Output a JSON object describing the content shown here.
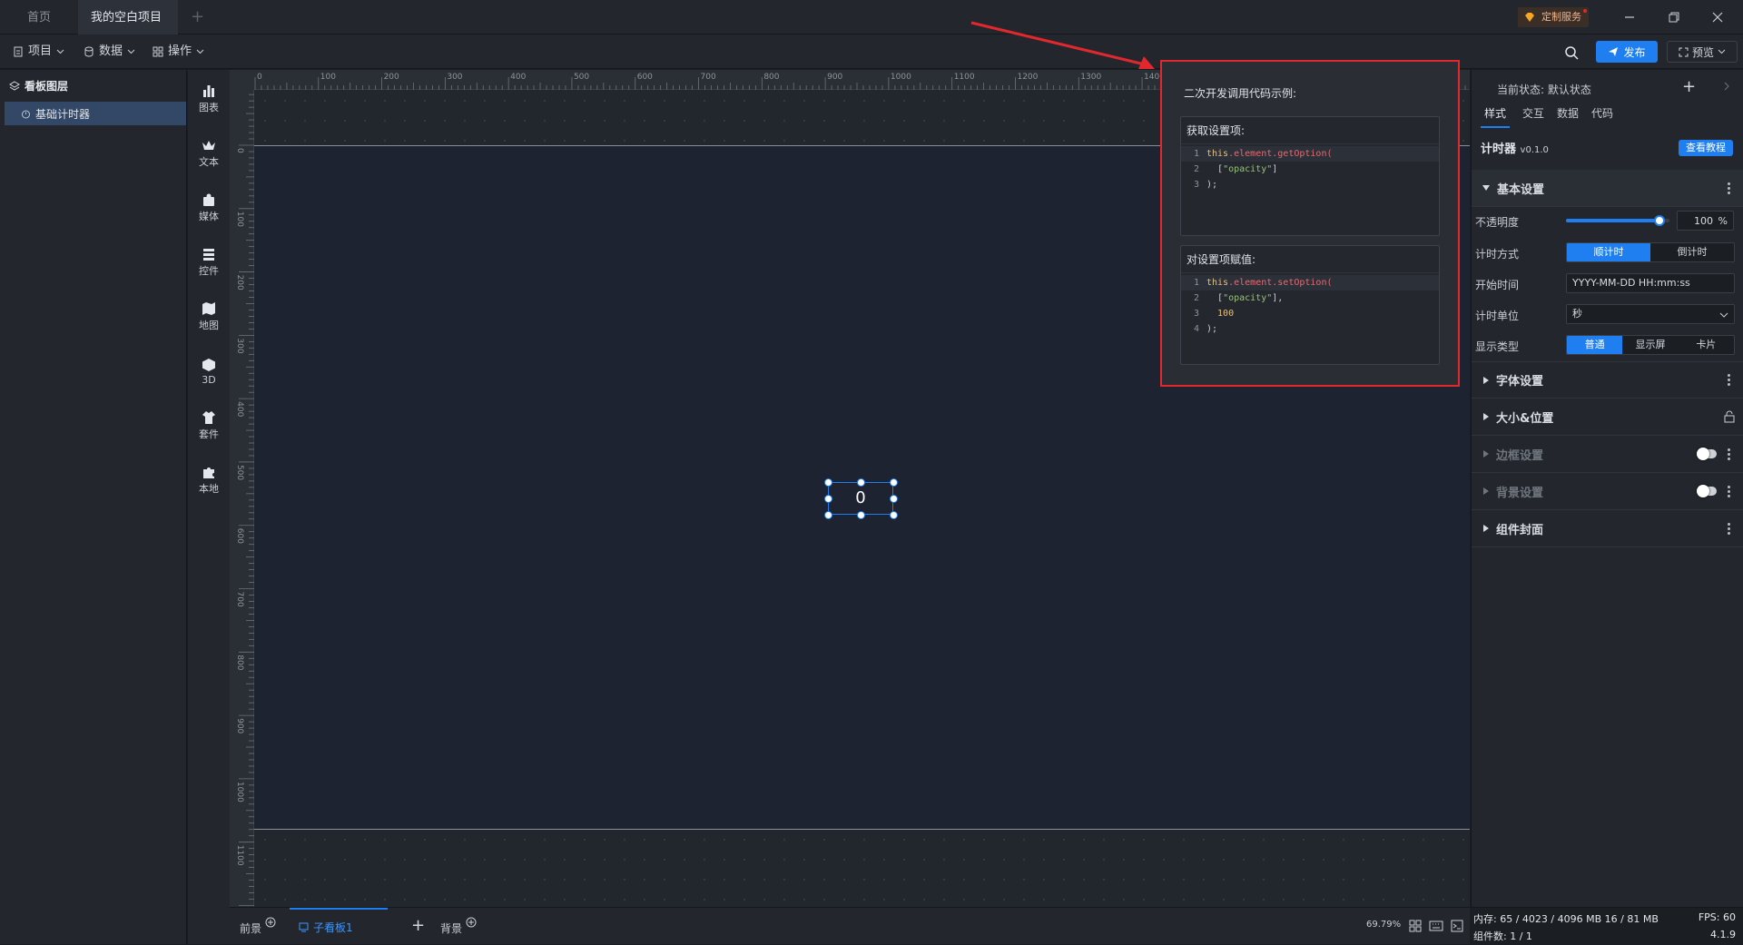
{
  "tabs": {
    "home": "首页",
    "project": "我的空白项目"
  },
  "titlebar": {
    "service_label": "定制服务"
  },
  "toolbar": {
    "menus": [
      "项目",
      "数据",
      "操作"
    ],
    "publish_label": "发布",
    "preview_label": "预览"
  },
  "layers": {
    "title": "看板图层",
    "items": [
      {
        "label": "基础计时器"
      }
    ]
  },
  "components": [
    {
      "label": "图表",
      "icon": "chart-icon"
    },
    {
      "label": "文本",
      "icon": "text-icon"
    },
    {
      "label": "媒体",
      "icon": "media-icon"
    },
    {
      "label": "控件",
      "icon": "widget-icon"
    },
    {
      "label": "地图",
      "icon": "map-icon"
    },
    {
      "label": "3D",
      "icon": "cube-icon"
    },
    {
      "label": "套件",
      "icon": "kit-icon"
    },
    {
      "label": "本地",
      "icon": "puzzle-icon"
    }
  ],
  "rulers": {
    "top": [
      "0",
      "100",
      "200",
      "300",
      "400",
      "500",
      "600",
      "700",
      "800",
      "900",
      "1000",
      "1100",
      "1200",
      "1300",
      "1400"
    ],
    "left": [
      "0",
      "100",
      "200",
      "300",
      "400",
      "500",
      "600",
      "700",
      "800",
      "900",
      "1000",
      "1100"
    ]
  },
  "canvas": {
    "timer_value": "0"
  },
  "popup": {
    "title": "二次开发调用代码示例:",
    "get_title": "获取设置项:",
    "get_code": [
      {
        "n": "1",
        "parts": [
          [
            "kw",
            "this"
          ],
          [
            "fn",
            ".element.getOption("
          ]
        ]
      },
      {
        "n": "2",
        "parts": [
          [
            "pl",
            "  ["
          ],
          [
            "str",
            "\"opacity\""
          ],
          [
            "pl",
            "]"
          ]
        ]
      },
      {
        "n": "3",
        "parts": [
          [
            "pl",
            ");"
          ]
        ]
      }
    ],
    "set_title": "对设置项赋值:",
    "set_code": [
      {
        "n": "1",
        "parts": [
          [
            "kw",
            "this"
          ],
          [
            "fn",
            ".element.setOption("
          ]
        ]
      },
      {
        "n": "2",
        "parts": [
          [
            "pl",
            "  ["
          ],
          [
            "str",
            "\"opacity\""
          ],
          [
            "pl",
            "],"
          ]
        ]
      },
      {
        "n": "3",
        "parts": [
          [
            "num",
            "  100"
          ]
        ]
      },
      {
        "n": "4",
        "parts": [
          [
            "pl",
            ");"
          ]
        ]
      }
    ]
  },
  "bottombar": {
    "foreground": "前景",
    "child_board": "子看板1",
    "background": "背景",
    "zoom": "69.79%"
  },
  "rightpanel": {
    "state_label": "当前状态:",
    "state_value": "默认状态",
    "tabs": [
      "样式",
      "交互",
      "数据",
      "代码"
    ],
    "component_name": "计时器",
    "version": "v0.1.0",
    "tutorial": "查看教程",
    "sections": {
      "basic": "基本设置",
      "font": "字体设置",
      "size": "大小&位置",
      "border": "边框设置",
      "bg": "背景设置",
      "cover": "组件封面"
    },
    "opacity": {
      "label": "不透明度",
      "value": "100",
      "unit": "%",
      "level": 0.9
    },
    "mode": {
      "label": "计时方式",
      "options": [
        "顺计时",
        "倒计时"
      ],
      "selected": 0
    },
    "start": {
      "label": "开始时间",
      "value": "YYYY-MM-DD HH:mm:ss"
    },
    "unit": {
      "label": "计时单位",
      "value": "秒"
    },
    "display": {
      "label": "显示类型",
      "options": [
        "普通",
        "显示屏",
        "卡片"
      ],
      "selected": 0
    }
  },
  "status": {
    "memory_label": "内存:",
    "memory_value": "65 / 4023 / 4096 MB  16 / 81 MB",
    "fps_label": "FPS:",
    "fps_value": "60",
    "count_label": "组件数:",
    "count_value": "1 / 1",
    "version": "4.1.9"
  },
  "colors": {
    "accent": "#1f7ff0",
    "highlight": "#e0282e",
    "dot": "#f3b13a"
  }
}
